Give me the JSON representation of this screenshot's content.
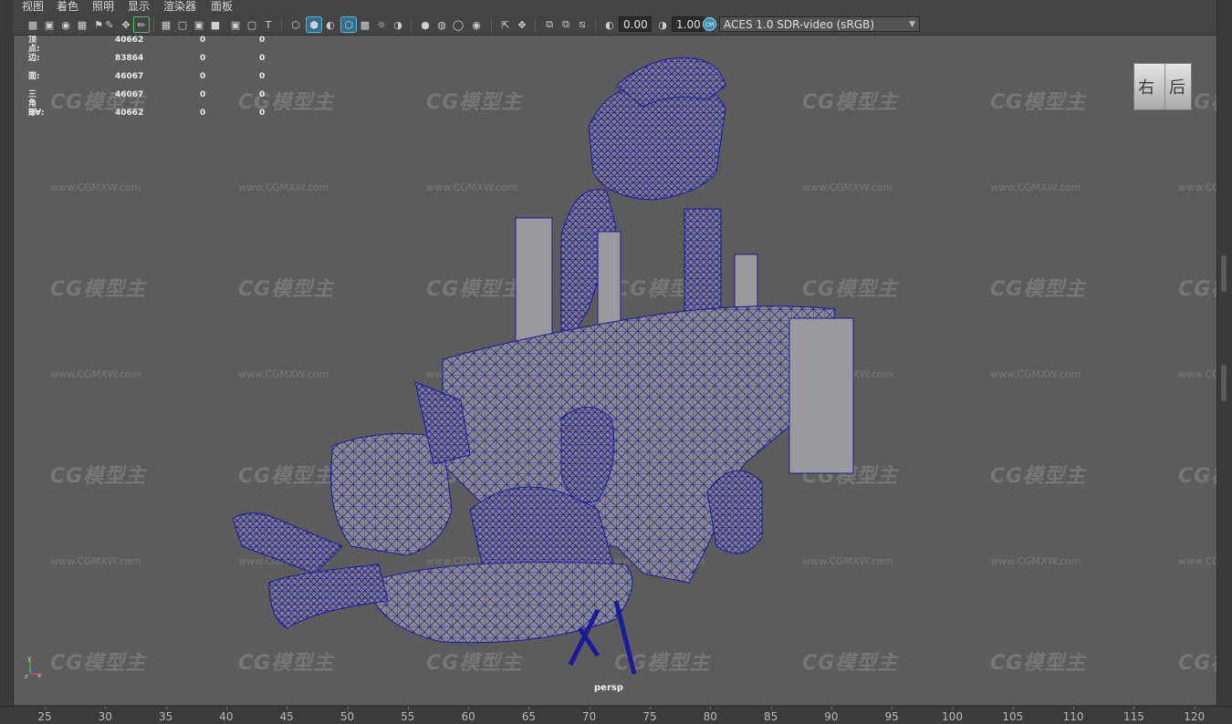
{
  "menu": [
    "视图",
    "着色",
    "照明",
    "显示",
    "渲染器",
    "面板"
  ],
  "toolbar": {
    "exposure": "0.00",
    "gamma": "1.00",
    "color_space": "ACES 1.0 SDR-video (sRGB)"
  },
  "hud": [
    {
      "label": "顶点:",
      "values": [
        "40662",
        "0",
        "0"
      ]
    },
    {
      "label": "边:",
      "values": [
        "83864",
        "0",
        "0"
      ]
    },
    {
      "label": "面:",
      "values": [
        "46067",
        "0",
        "0"
      ]
    },
    {
      "label": "三角形:",
      "values": [
        "46067",
        "0",
        "0"
      ]
    },
    {
      "label": "UV:",
      "values": [
        "40662",
        "0",
        "0"
      ]
    }
  ],
  "viewcube": {
    "face_left": "右",
    "face_right": "后"
  },
  "camera": "persp",
  "watermark": {
    "logo_text": "CG模型主",
    "url": "www.CGMXW.com"
  },
  "timeline": {
    "ticks": [
      "25",
      "30",
      "35",
      "40",
      "45",
      "50",
      "55",
      "60",
      "65",
      "70",
      "75",
      "80",
      "85",
      "90",
      "95",
      "100",
      "105",
      "110",
      "115",
      "120"
    ]
  },
  "colors": {
    "wire": "#1a1a9c",
    "mesh": "#8a8a8e",
    "viewport_bg": "#5c5c5c",
    "accent": "#3d8fb0"
  }
}
